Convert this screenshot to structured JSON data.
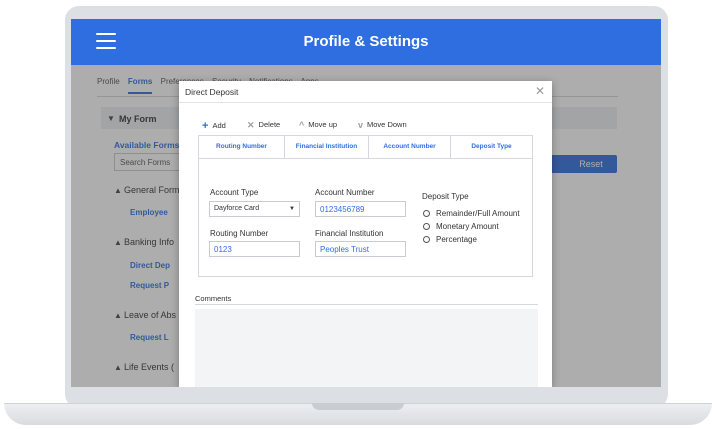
{
  "header": {
    "title": "Profile & Settings"
  },
  "page": {
    "tabs": [
      {
        "label": "Profile"
      },
      {
        "label": "Forms"
      },
      {
        "label": "Preferences"
      },
      {
        "label": "Security"
      },
      {
        "label": "Notifications"
      },
      {
        "label": "Apps"
      }
    ],
    "my_forms_label": "My Form",
    "available_forms_label": "Available Forms",
    "search_placeholder": "Search Forms",
    "reset_label": "Reset",
    "sections": [
      {
        "title": "General Forms",
        "links": [
          "Employee"
        ]
      },
      {
        "title": "Banking Info",
        "links": [
          "Direct Dep",
          "Request P"
        ]
      },
      {
        "title": "Leave of Abs",
        "links": [
          "Request L"
        ]
      },
      {
        "title": "Life Events (",
        "links": []
      }
    ]
  },
  "modal": {
    "title": "Direct Deposit",
    "close_glyph": "✕",
    "toolbar": {
      "add_label": "Add",
      "delete_label": "Delete",
      "move_up_label": "Move up",
      "move_down_label": "Move Down"
    },
    "grid_columns": [
      "Routing Number",
      "Financial Institution",
      "Account Number",
      "Deposit Type"
    ],
    "form": {
      "account_type_label": "Account Type",
      "account_type_value": "Dayforce Card",
      "account_number_label": "Account Number",
      "account_number_value": "0123456789",
      "routing_number_label": "Routing Number",
      "routing_number_value": "0123",
      "financial_institution_label": "Financial Institution",
      "financial_institution_value": "Peoples Trust",
      "deposit_type_label": "Deposit Type",
      "deposit_type_options": [
        "Remainder/Full Amount",
        "Monetary Amount",
        "Percentage"
      ]
    },
    "comments_label": "Comments"
  },
  "colors": {
    "brand_blue": "#2f6ee0"
  }
}
